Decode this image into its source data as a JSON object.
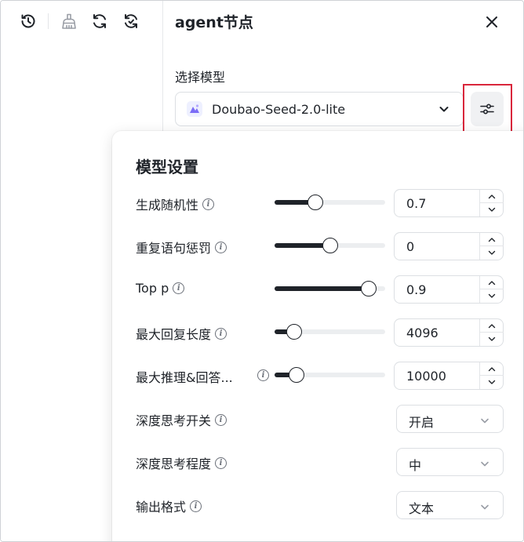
{
  "toolbar": {
    "icons": [
      "history-icon",
      "clear-broom-icon",
      "refresh-icon",
      "sync-icon"
    ]
  },
  "panel": {
    "title": "agent节点",
    "model_section_label": "选择模型",
    "selected_model": "Doubao-Seed-2.0-lite"
  },
  "model_settings": {
    "title": "模型设置",
    "temperature": {
      "label": "生成随机性",
      "value": "0.7",
      "slider_fraction": 0.37
    },
    "repeat_penalty": {
      "label": "重复语句惩罚",
      "value": "0",
      "slider_fraction": 0.5
    },
    "top_p": {
      "label": "Top p",
      "value": "0.9",
      "slider_fraction": 0.85
    },
    "max_reply_length": {
      "label": "最大回复长度",
      "value": "4096",
      "slider_fraction": 0.18
    },
    "max_reasoning_length": {
      "label": "最大推理&回答...",
      "value": "10000",
      "slider_fraction": 0.2
    },
    "deep_thinking_switch": {
      "label": "深度思考开关",
      "value": "开启"
    },
    "deep_thinking_level": {
      "label": "深度思考程度",
      "value": "中"
    },
    "output_format": {
      "label": "输出格式",
      "value": "文本"
    }
  },
  "colors": {
    "accent": "#1f2329",
    "highlight_border": "#d9263b",
    "track": "#eceef0"
  }
}
